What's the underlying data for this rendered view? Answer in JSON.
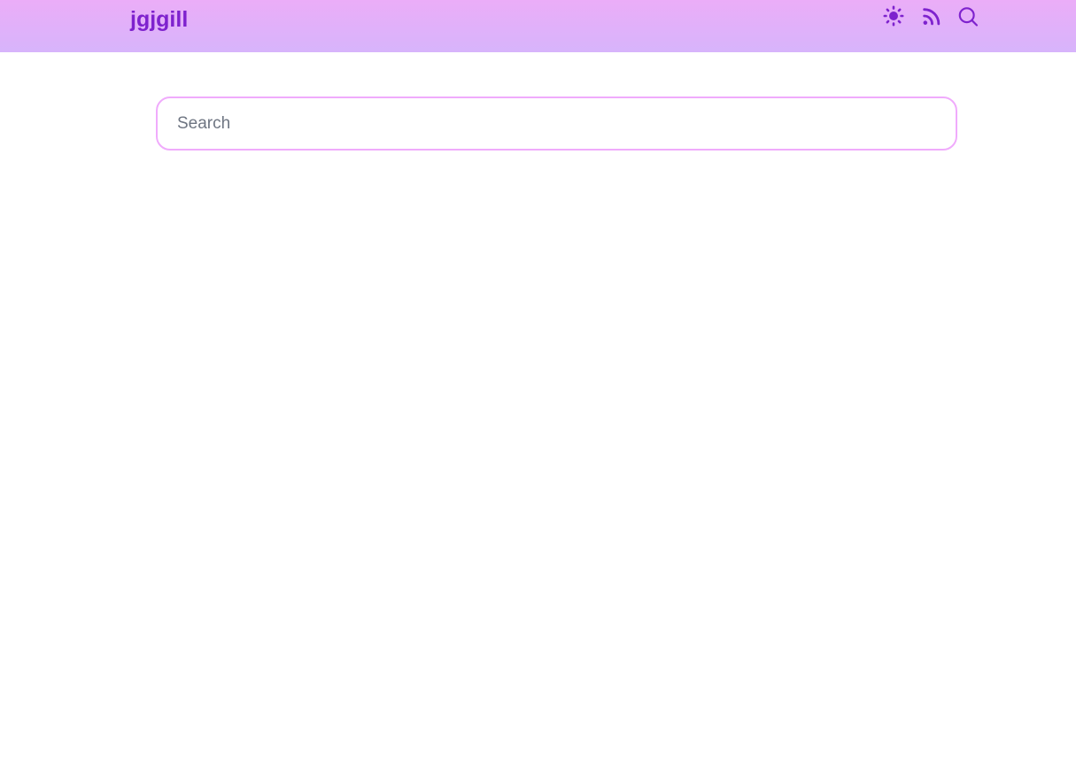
{
  "header": {
    "logo_text": "jgjgill",
    "actions": [
      {
        "name": "theme-toggle",
        "icon": "sun-icon"
      },
      {
        "name": "rss-feed",
        "icon": "rss-icon"
      },
      {
        "name": "search-toggle",
        "icon": "search-icon"
      }
    ]
  },
  "search": {
    "placeholder": "Search",
    "value": ""
  },
  "colors": {
    "header_gradient_top": "#ebadf8",
    "header_gradient_bottom": "#d7b4fb",
    "logo_purple": "#7e22ce",
    "icon_purple": "#7e22ce",
    "search_border_pink": "#f0abfc",
    "placeholder_gray": "#6e7582",
    "page_background": "#ffffff"
  }
}
